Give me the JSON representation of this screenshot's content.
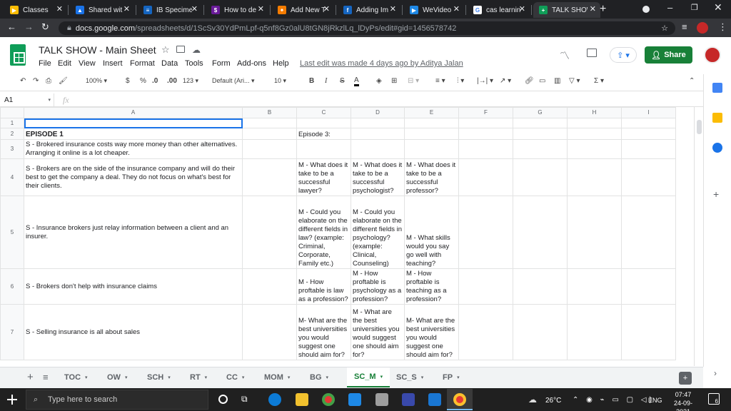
{
  "browser": {
    "tabs": [
      {
        "title": "Classes",
        "color": "#fbbc04",
        "glyph": "▶"
      },
      {
        "title": "Shared wit",
        "color": "#1a73e8",
        "glyph": "▲"
      },
      {
        "title": "IB Specime",
        "color": "#1565c0",
        "glyph": "≡"
      },
      {
        "title": "How to de",
        "color": "#6a1b9a",
        "glyph": "$"
      },
      {
        "title": "Add New T",
        "color": "#f57c00",
        "glyph": "✦"
      },
      {
        "title": "Adding Im",
        "color": "#1565c0",
        "glyph": "f"
      },
      {
        "title": "WeVideo",
        "color": "#1e88e5",
        "glyph": "▶"
      },
      {
        "title": "cas learnin",
        "color": "#ffffff",
        "glyph": "G"
      },
      {
        "title": "TALK SHOW",
        "color": "#0f9d58",
        "glyph": "+"
      }
    ],
    "url_host": "docs.google.com",
    "url_path": "/spreadsheets/d/1ScSv30YdPmLpf-q5nf8Gz0alU8tGN8jRkzlLq_lDyPs/edit#gid=1456578742"
  },
  "sheets": {
    "title": "TALK SHOW - Main Sheet",
    "menu": [
      "File",
      "Edit",
      "View",
      "Insert",
      "Format",
      "Data",
      "Tools",
      "Form",
      "Add-ons",
      "Help"
    ],
    "last_edit": "Last edit was made 4 days ago by Aditya Jalan",
    "share_label": "Share",
    "zoom": "100%",
    "currency": "$",
    "percent": "%",
    "dec_less": ".0",
    "dec_more": ".00",
    "num_format": "123",
    "font": "Default (Ari...",
    "font_size": "10",
    "cell_ref": "A1",
    "fx": "fx"
  },
  "grid": {
    "columns": [
      "A",
      "B",
      "C",
      "D",
      "E",
      "F",
      "G",
      "H",
      "I"
    ],
    "rows": [
      {
        "num": "1",
        "A": "",
        "B": "",
        "C": "",
        "D": "",
        "E": ""
      },
      {
        "num": "2",
        "A": "EPISODE 1",
        "B": "",
        "C": "Episode 3:",
        "D": "",
        "E": ""
      },
      {
        "num": "3",
        "A": "S - Brokered insurance costs way more money than other alternatives. Arranging it online is a lot cheaper.",
        "B": "",
        "C": "",
        "D": "",
        "E": ""
      },
      {
        "num": "4",
        "A": "S - Brokers are on the side of the insurance company and will do their best to get the company a deal. They do not focus on what's best for their clients.",
        "B": "",
        "C": "M - What does it take to be a successful lawyer?",
        "D": "M - What does it take to be a successful psychologist?",
        "E": "M - What does it take to be a successful professor?"
      },
      {
        "num": "5",
        "A": "S - Insurance brokers just relay information between a client and an insurer.",
        "B": "",
        "C": "M - Could you elaborate on the different fields in law? (example: Criminal, Corporate, Family etc.)",
        "D": "M - Could you elaborate on the different fields in psychology? (example: Clinical, Counseling)",
        "E": "M - What skills would you say go well with teaching?"
      },
      {
        "num": "6",
        "A": "S - Brokers don't help with insurance claims",
        "B": "",
        "C": "M - How proftable is law as a profession?",
        "D": "M - How proftable is psychology as a profession?",
        "E": "M - How proftable is teaching as a profession?"
      },
      {
        "num": "7",
        "A": "S - Selling insurance is all about sales",
        "B": "",
        "C": "M- What are the best universities you would suggest one should aim for?",
        "D": "M - What are the best universities you would suggest one should aim for?",
        "E": "M- What are the best universities you would suggest one should aim for?"
      }
    ]
  },
  "sheet_tabs": [
    {
      "label": "TOC"
    },
    {
      "label": "OW"
    },
    {
      "label": "SCH"
    },
    {
      "label": "RT"
    },
    {
      "label": "CC"
    },
    {
      "label": "MOM"
    },
    {
      "label": "BG"
    },
    {
      "label": "SC_M"
    },
    {
      "label": "SC_S"
    },
    {
      "label": "FP"
    }
  ],
  "taskbar": {
    "search_placeholder": "Type here to search",
    "weather": "26°C",
    "lang": "ENG",
    "time": "07:47",
    "date": "24-09-2021",
    "notif_count": "6"
  }
}
